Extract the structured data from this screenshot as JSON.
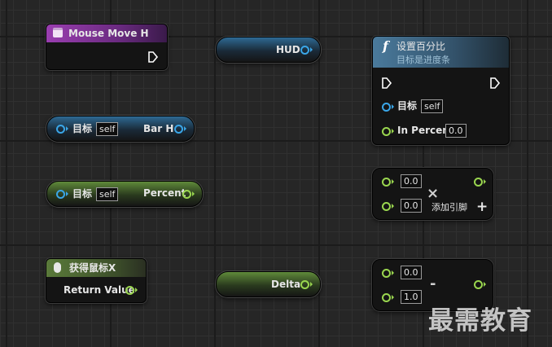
{
  "event_node": {
    "title": "Mouse Move H"
  },
  "hud_pill": {
    "label": "HUD"
  },
  "barh_node": {
    "target_label": "目标",
    "target_value": "self",
    "output_label": "Bar H"
  },
  "percent_node": {
    "target_label": "目标",
    "target_value": "self",
    "output_label": "Percent"
  },
  "mouse_node": {
    "title": "获得鼠标X",
    "output_label": "Return Value"
  },
  "delta_pill": {
    "label": "Delta"
  },
  "set_percent_node": {
    "func_glyph": "f",
    "title": "设置百分比",
    "subtitle": "目标是进度条",
    "target_label": "目标",
    "target_value": "self",
    "percent_label": "In Percent",
    "percent_value": "0.0"
  },
  "multiply_node": {
    "a": "0.0",
    "b": "0.0",
    "add_pin_label": "添加引脚",
    "operator": "×"
  },
  "subtract_node": {
    "a": "0.0",
    "b": "1.0",
    "operator": "-"
  },
  "watermark": "最需教育",
  "colors": {
    "object_pin": "#3aa6e8",
    "float_pin": "#9ad64f",
    "event_header": "#7a2a8c",
    "function_header": "#3f6f8f"
  }
}
